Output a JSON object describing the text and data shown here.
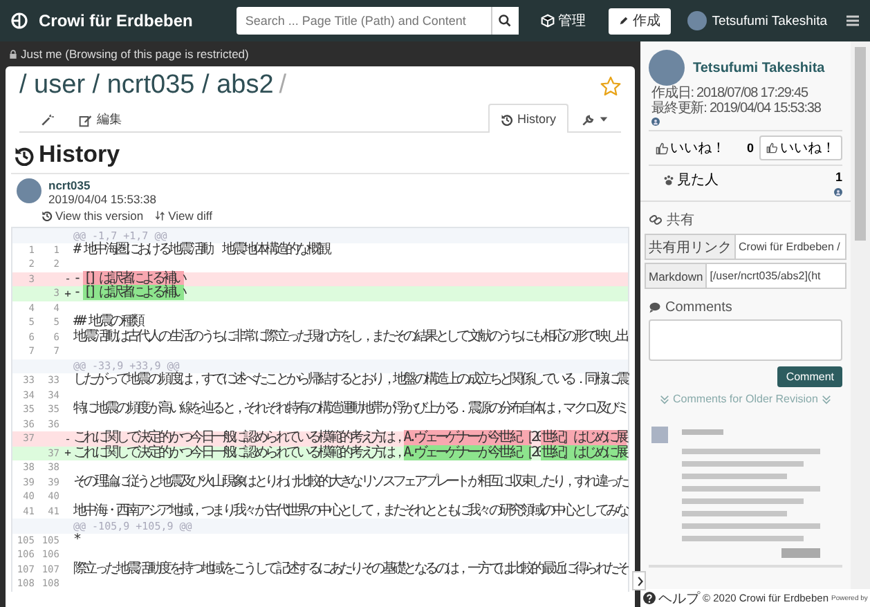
{
  "navbar": {
    "brand": "Crowi für Erdbeben",
    "search_placeholder": "Search ... Page Title (Path) and Content",
    "admin_label": "管理",
    "create_label": "作成",
    "user_name": "Tetsufumi Takeshita"
  },
  "restriction": "Just me (Browsing of this page is restricted)",
  "page": {
    "title": "/ user / ncrt035 / abs2",
    "title_trailing": "/",
    "starred": false,
    "tabs": [
      {
        "kind": "wand",
        "selected": false
      },
      {
        "kind": "edit",
        "label": "編集",
        "selected": false
      },
      {
        "kind": "history",
        "label": "History",
        "selected": true
      },
      {
        "kind": "tools",
        "selected": false
      }
    ]
  },
  "history": {
    "heading": "History",
    "author": "ncrt035",
    "date": "2019/04/04 15:53:38",
    "links": [
      {
        "kind": "version",
        "label": "View this version"
      },
      {
        "kind": "diff",
        "label": "View diff"
      }
    ],
    "diff": [
      {
        "kind": "hunk",
        "text": "@@ -1,7 +1,7 @@"
      },
      {
        "kind": "context",
        "old": "1",
        "new": "1",
        "text": "# 地中海圏における地震活動　地震地体構造的な概観"
      },
      {
        "kind": "context",
        "old": "2",
        "new": "2"
      },
      {
        "kind": "del",
        "old": "3",
        "marker": "-",
        "segments": [
          {
            "text": "- ",
            "changed": false
          },
          {
            "text": "[] は訳者による補い",
            "changed": true
          }
        ]
      },
      {
        "kind": "add",
        "new": "3",
        "marker": "+",
        "segments": [
          {
            "text": "- ",
            "changed": false
          },
          {
            "text": "[] は訳者による補い",
            "changed": true
          }
        ]
      },
      {
        "kind": "context",
        "old": "4",
        "new": "4"
      },
      {
        "kind": "context",
        "old": "5",
        "new": "5",
        "text": "## 地震の種類"
      },
      {
        "kind": "context",
        "old": "6",
        "new": "6",
        "text": "地震活動は古代人の生活のうちに非常に際立った現れ方をし，またその結果として文献のうちにも相応の形で映し出"
      },
      {
        "kind": "context",
        "old": "7",
        "new": "7"
      },
      {
        "kind": "hunk",
        "text": "@@ -33,9 +33,9 @@"
      },
      {
        "kind": "context",
        "old": "33",
        "new": "33",
        "text": "したがって地震の頻度は，すでに述べたことから帰結するとおり，地盤の構造上の成立ちと関係している．同様に震"
      },
      {
        "kind": "context",
        "old": "34",
        "new": "34"
      },
      {
        "kind": "context",
        "old": "35",
        "new": "35",
        "text": "特に地震の頻度が高い線を辿ると，それぞれ特有の構造運動地帯が浮かび上がる．震源の分布自体は，マクロ及びミ"
      },
      {
        "kind": "context",
        "old": "36",
        "new": "36"
      },
      {
        "kind": "del",
        "old": "37",
        "marker": "-",
        "segments": [
          {
            "text": "これに関して決定的かつ今日一般に認められている模範的考え方は，",
            "changed": false
          },
          {
            "text": "A.ヴェーゲナーが今世紀［",
            "changed": true
          },
          {
            "text": "20",
            "changed": false
          },
          {
            "text": "世紀］はじめに展",
            "changed": true
          }
        ]
      },
      {
        "kind": "add",
        "new": "37",
        "marker": "+",
        "segments": [
          {
            "text": "これに関して決定的かつ今日一般に認められている模範的考え方は，",
            "changed": false
          },
          {
            "text": "A.ヴェーゲナーが今世紀［",
            "changed": true
          },
          {
            "text": "20",
            "changed": false
          },
          {
            "text": "世紀］はじめに展",
            "changed": true
          }
        ]
      },
      {
        "kind": "context",
        "old": "38",
        "new": "38"
      },
      {
        "kind": "context",
        "old": "39",
        "new": "39",
        "text": "その理論に従うと地震及び火山現象はとりわけ比較的大きなリソスフェアプレートが相互に収束したり，すれ違った"
      },
      {
        "kind": "context",
        "old": "40",
        "new": "40"
      },
      {
        "kind": "context",
        "old": "41",
        "new": "41",
        "text": "地中海・西南アジア地域，つまり我々が古代世界の中心として，またそれとともに我々の研究領域の中心としてみな"
      },
      {
        "kind": "hunk",
        "text": "@@ -105,9 +105,9 @@"
      },
      {
        "kind": "context",
        "old": "105",
        "new": "105",
        "text": "*"
      },
      {
        "kind": "context",
        "old": "106",
        "new": "106"
      },
      {
        "kind": "context",
        "old": "107",
        "new": "107",
        "text": "際立った地震活動度を持つ地域をこうして記述するにあたりその基礎となるのは，一方では比較的最近に得られたそ"
      },
      {
        "kind": "context",
        "old": "108",
        "new": "108"
      }
    ]
  },
  "sidebar": {
    "author_name": "Tetsufumi Takeshita",
    "created": "作成日: 2018/07/08 17:29:45",
    "updated": "最終更新: 2019/04/04 15:53:38",
    "likes": {
      "label": "いいね！",
      "count": "0",
      "button": "いいね！"
    },
    "seen": {
      "label": "見た人",
      "count": "1"
    },
    "share": {
      "heading": "共有",
      "rows": [
        {
          "label": "共有用リンク",
          "value": "Crowi für Erdbeben /"
        },
        {
          "label": "Markdown",
          "value": "[/user/ncrt035/abs2](ht"
        }
      ]
    },
    "comments": {
      "heading": "Comments",
      "button": "Comment",
      "older_label": "Comments for Older Revision"
    },
    "footer": {
      "help": "ヘルプ",
      "copyright": "© 2020 Crowi für Erdbeben",
      "powered": "Powered by"
    }
  }
}
